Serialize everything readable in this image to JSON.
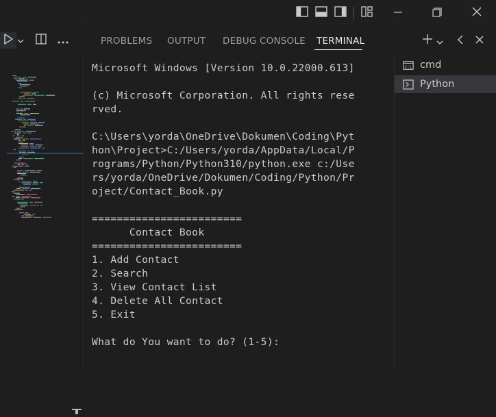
{
  "panel": {
    "tabs": [
      {
        "label": "PROBLEMS"
      },
      {
        "label": "OUTPUT"
      },
      {
        "label": "DEBUG CONSOLE"
      },
      {
        "label": "TERMINAL"
      }
    ],
    "active_tab": "TERMINAL"
  },
  "terminal": {
    "lines": [
      "Microsoft Windows [Version 10.0.22000.613]",
      "",
      "(c) Microsoft Corporation. All rights rese",
      "rved.",
      "",
      "C:\\Users\\yorda\\OneDrive\\Dokumen\\Coding\\Pyt",
      "hon\\Project>C:/Users/yorda/AppData/Local/P",
      "rograms/Python/Python310/python.exe c:/Use",
      "rs/yorda/OneDrive/Dokumen/Coding/Python/Pr",
      "oject/Contact_Book.py",
      "",
      "========================",
      "      Contact Book",
      "========================",
      "1. Add Contact",
      "2. Search",
      "3. View Contact List",
      "4. Delete All Contact",
      "5. Exit",
      "",
      "What do You want to do? (1-5):"
    ]
  },
  "terminal_list": {
    "items": [
      {
        "label": "cmd",
        "icon": "cmd-icon"
      },
      {
        "label": "Python",
        "icon": "terminal-icon",
        "selected": true
      }
    ]
  },
  "colors": {
    "background": "#1e1e1e",
    "text": "#cccccc",
    "selected_row": "#37373d"
  }
}
